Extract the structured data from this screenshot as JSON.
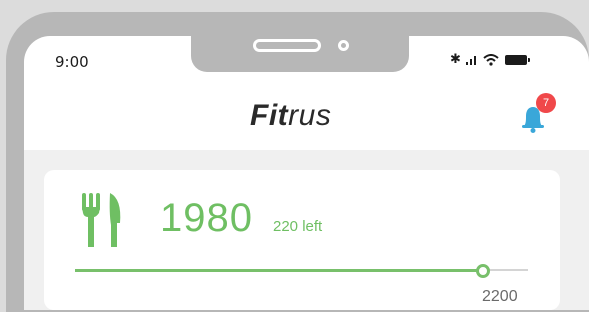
{
  "status_bar": {
    "time": "9:00",
    "icons": [
      "bluetooth-icon",
      "signal-icon",
      "wifi-icon",
      "battery-icon"
    ]
  },
  "header": {
    "brand_bold": "Fit",
    "brand_light": "rus",
    "notification_count": "7"
  },
  "calorie_card": {
    "value": "1980",
    "left_label": "220 left",
    "goal": "2200",
    "progress_fraction": 0.9,
    "accent_color": "#6fbf63"
  }
}
